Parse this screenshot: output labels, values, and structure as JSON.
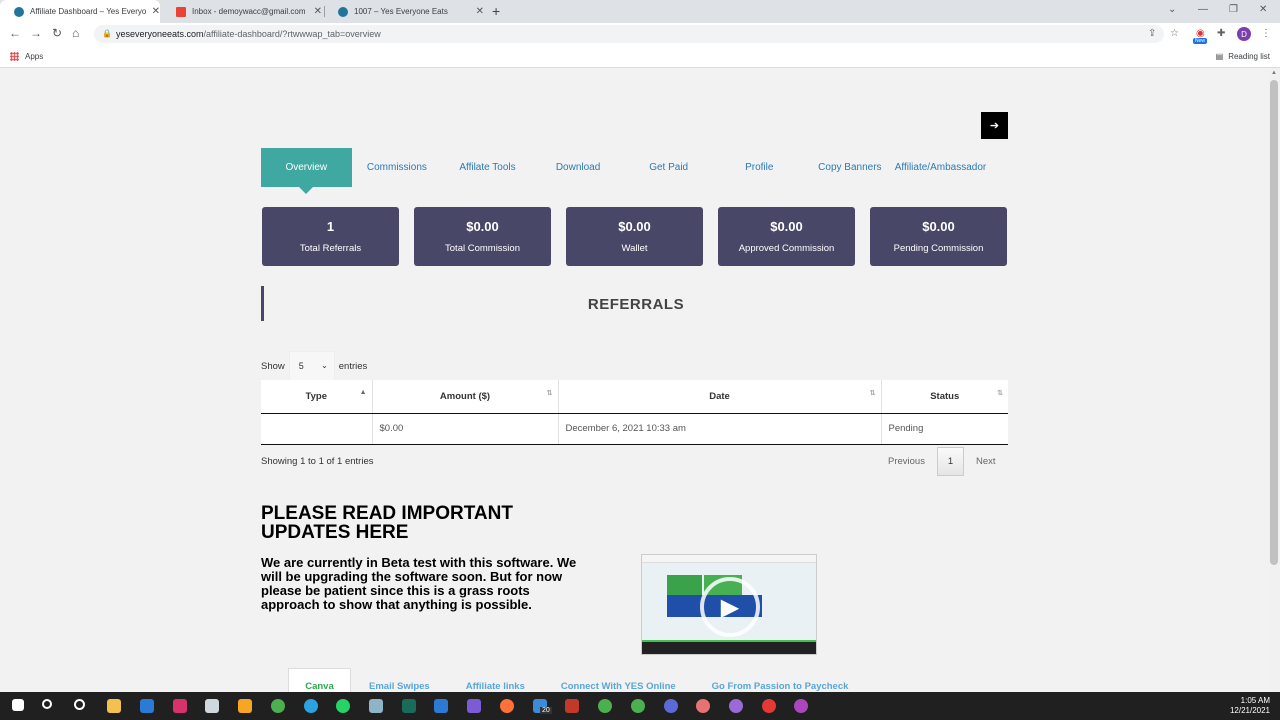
{
  "browser": {
    "tabs": [
      {
        "title": "Affiliate Dashboard – Yes Everyone Eats",
        "close": "✕"
      },
      {
        "title": "Inbox - demoywacc@gmail.com",
        "close": "✕"
      },
      {
        "title": "1007 – Yes Everyone Eats",
        "close": "✕"
      }
    ],
    "new_tab": "+",
    "url_host": "yeseveryoneeats.com",
    "url_path": "/affiliate-dashboard/?rtwwwap_tab=overview",
    "profile_initial": "D",
    "new_badge": "New",
    "bookmarks_apps": "Apps",
    "reading_list": "Reading list"
  },
  "menu": {
    "items": [
      "Overview",
      "Commissions",
      "Affilate Tools",
      "Download",
      "Get Paid",
      "Profile",
      "Copy Banners",
      "Affiliate/Ambassador"
    ]
  },
  "cards": [
    {
      "value": "1",
      "label": "Total Referrals"
    },
    {
      "value": "$0.00",
      "label": "Total Commission"
    },
    {
      "value": "$0.00",
      "label": "Wallet"
    },
    {
      "value": "$0.00",
      "label": "Approved Commission"
    },
    {
      "value": "$0.00",
      "label": "Pending Commission"
    }
  ],
  "referrals": {
    "title": "REFERRALS",
    "show_label": "Show",
    "entries_value": "5",
    "entries_label": "entries",
    "columns": [
      "Type",
      "Amount ($)",
      "Date",
      "Status"
    ],
    "rows": [
      {
        "type": "",
        "amount": "$0.00",
        "date": "December 6, 2021 10:33 am",
        "status": "Pending"
      }
    ],
    "showing_text": "Showing 1 to 1 of 1 entries",
    "pager": {
      "previous": "Previous",
      "current": "1",
      "next": "Next"
    }
  },
  "updates": {
    "title": "PLEASE READ IMPORTANT UPDATES HERE",
    "text": "We are currently in Beta test with this software. We will be upgrading the software soon. But for now please be patient since this is a grass roots approach to show that anything is possible."
  },
  "subtabs": [
    "Canva",
    "Email Swipes",
    "Affiliate links",
    "Connect With YES Online",
    "Go From Passion to Paycheck"
  ],
  "taskbar": {
    "time": "1:05 AM",
    "date": "12/21/2021",
    "badge": "20"
  },
  "colors": {
    "active_tab": "#3fa8a0",
    "card_bg": "#494767",
    "link": "#2d7ab3"
  }
}
